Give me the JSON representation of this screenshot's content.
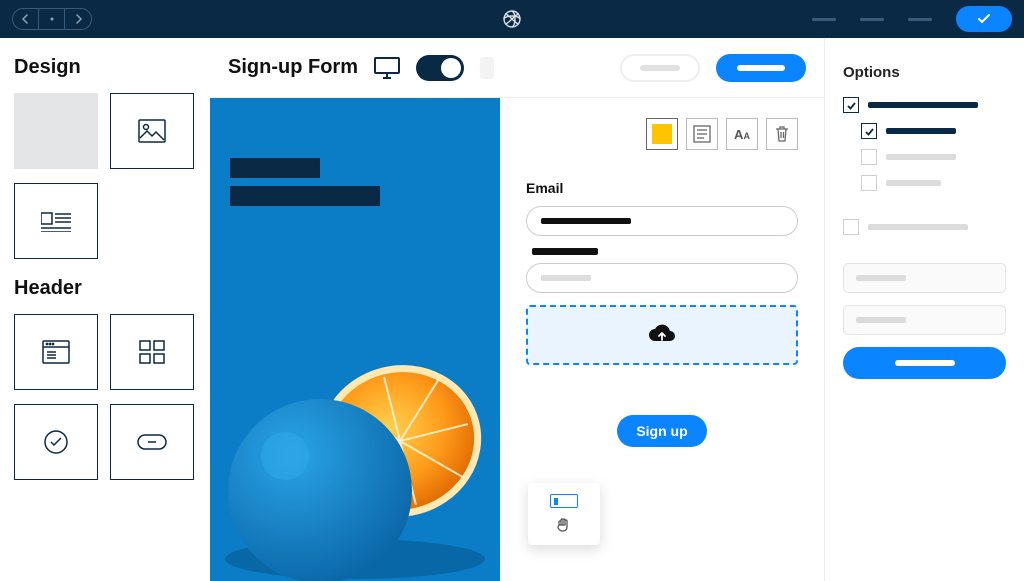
{
  "topbar": {
    "logo_label": "app-logo"
  },
  "sidebar": {
    "design_title": "Design",
    "header_title": "Header"
  },
  "center": {
    "title": "Sign-up Form"
  },
  "form": {
    "email_label": "Email",
    "signup_label": "Sign up"
  },
  "tool_labels": {
    "color": "color",
    "text_block": "text block",
    "font": "Aᴀ",
    "delete": "delete"
  },
  "right": {
    "title": "Options"
  }
}
